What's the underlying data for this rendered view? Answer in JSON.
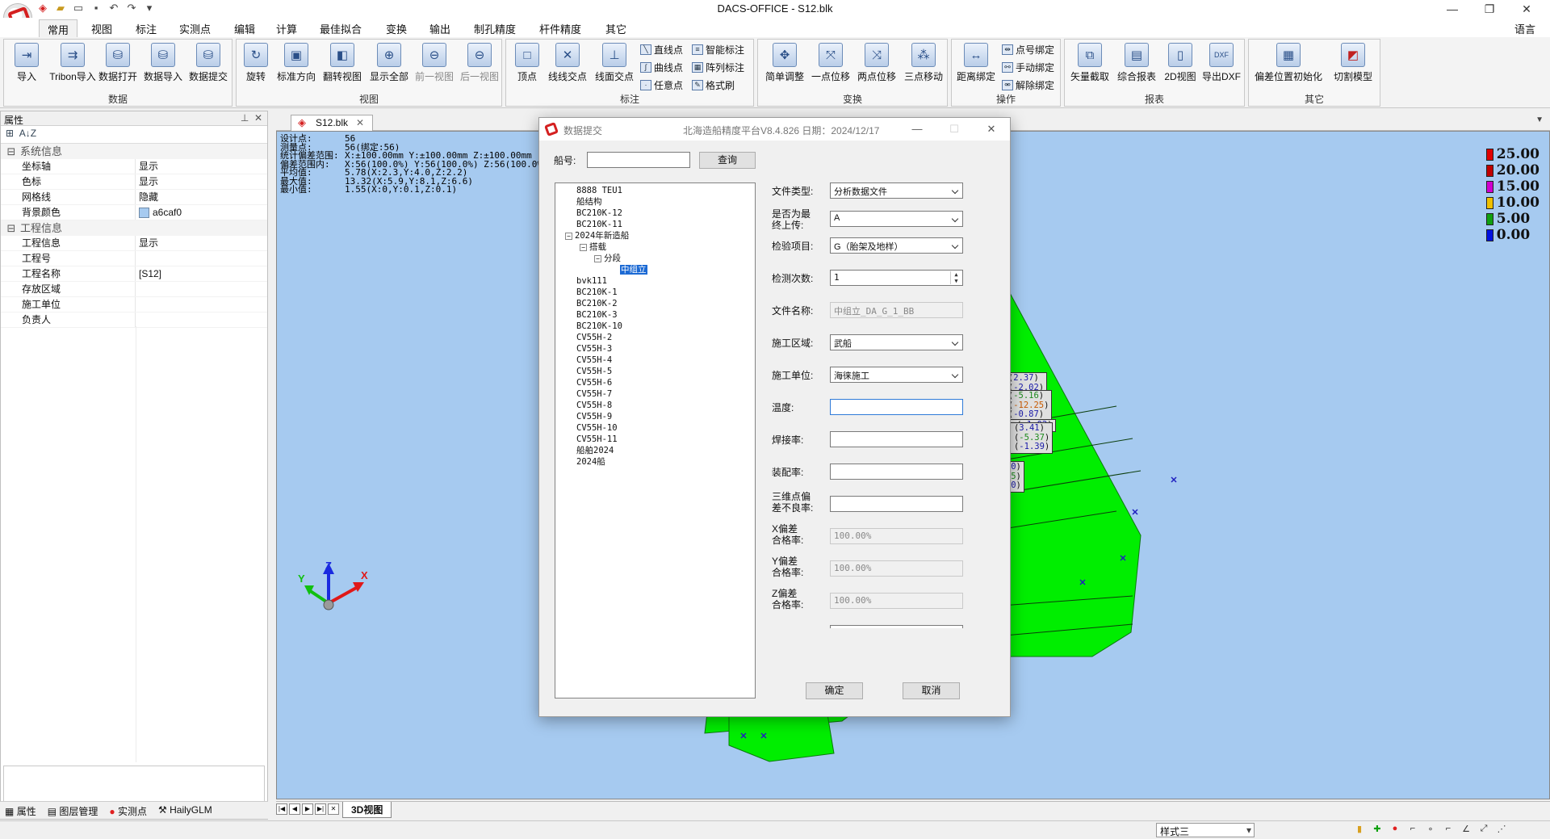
{
  "app": {
    "title": "DACS-OFFICE  -  S12.blk",
    "language_label": "语言",
    "tabs": [
      "常用",
      "视图",
      "标注",
      "实测点",
      "编辑",
      "计算",
      "最佳拟合",
      "变换",
      "输出",
      "制孔精度",
      "杆件精度",
      "其它"
    ]
  },
  "ribbon": {
    "groups": {
      "data": "数据",
      "view": "视图",
      "mark": "标注",
      "transform": "变换",
      "operate": "操作",
      "report": "报表",
      "other": "其它"
    },
    "buttons": {
      "import": "导入",
      "tribon_import": "Tribon导入",
      "data_open": "数据打开",
      "data_import": "数据导入",
      "data_submit": "数据提交",
      "rotate": "旋转",
      "std_direction": "标准方向",
      "flip_view": "翻转视图",
      "show_all": "显示全部",
      "prev_view": "前一视图",
      "next_view": "后一视图",
      "vertex": "顶点",
      "line_intersect": "线线交点",
      "line_plane_intersect": "线面交点",
      "line_point": "直线点",
      "curve_point": "曲线点",
      "any_point": "任意点",
      "smart_mark": "智能标注",
      "array_mark": "阵列标注",
      "format_brush": "格式刷",
      "simple_adjust": "简单调整",
      "one_point_move": "一点位移",
      "two_point_move": "两点位移",
      "three_point_move": "三点移动",
      "distance_bind": "距离绑定",
      "point_bind": "点号绑定",
      "manual_bind": "手动绑定",
      "unbind": "解除绑定",
      "vector_capture": "矢量截取",
      "summary_report": "综合报表",
      "view_2d": "2D视图",
      "export_dxf": "导出DXF",
      "deviation_init": "偏差位置初始化",
      "cut_model": "切割模型"
    }
  },
  "left_panel": {
    "title": "属性",
    "categories": [
      {
        "name": "系统信息",
        "rows": [
          {
            "k": "坐标轴",
            "v": "显示"
          },
          {
            "k": "色标",
            "v": "显示"
          },
          {
            "k": "网格线",
            "v": "隐藏"
          },
          {
            "k": "背景颜色",
            "v": "a6caf0"
          }
        ]
      },
      {
        "name": "工程信息",
        "rows": [
          {
            "k": "工程信息",
            "v": "显示"
          },
          {
            "k": "工程号",
            "v": ""
          },
          {
            "k": "工程名称",
            "v": "[S12]"
          },
          {
            "k": "存放区域",
            "v": ""
          },
          {
            "k": "施工单位",
            "v": ""
          },
          {
            "k": "负责人",
            "v": ""
          }
        ]
      }
    ],
    "bottom_tabs": [
      "属性",
      "图层管理",
      "实测点",
      "HailyGLM"
    ]
  },
  "document": {
    "tab": "S12.blk",
    "view_tab": "3D视图",
    "background_color": "#a6caf0",
    "info": [
      {
        "label": "设计点:",
        "value": "56"
      },
      {
        "label": "测量点:",
        "value": "56(绑定:56)"
      },
      {
        "label": "统计偏差范围:",
        "value": "X:±100.00mm Y:±100.00mm Z:±100.00mm"
      },
      {
        "label": "偏差范围内:",
        "value": "X:56(100.0%) Y:56(100.0%) Z:56(100.0%)"
      },
      {
        "label": "平均值:",
        "value": "5.78(X:2.3,Y:4.0,Z:2.2)"
      },
      {
        "label": "最大值:",
        "value": "13.32(X:5.9,Y:8.1,Z:6.6)"
      },
      {
        "label": "最小值:",
        "value": "1.55(X:0,Y:0.1,Z:0.1)"
      }
    ],
    "legend": [
      {
        "value": "25.00",
        "color": "#e00000"
      },
      {
        "value": "20.00",
        "color": "#c00000"
      },
      {
        "value": "15.00",
        "color": "#d000d0"
      },
      {
        "value": "10.00",
        "color": "#f0c000"
      },
      {
        "value": "5.00",
        "color": "#10a010"
      },
      {
        "value": "0.00",
        "color": "#0010e0"
      }
    ],
    "axes": {
      "x": "X",
      "y": "Y",
      "z": "Z"
    }
  },
  "dialog": {
    "title": "数据提交",
    "subtitle": "北海造船精度平台V8.4.826 日期：2024/12/17",
    "ship_no_label": "船号:",
    "query_button": "查询",
    "tree": [
      "8888  TEU1",
      "船结构",
      "BC210K-12",
      "BC210K-11",
      "2024年新造船",
      "搭载",
      "分段",
      "中组立",
      "bvk111",
      "BC210K-1",
      "BC210K-2",
      "BC210K-3",
      "BC210K-10",
      "CV55H-2",
      "CV55H-3",
      "CV55H-4",
      "CV55H-5",
      "CV55H-6",
      "CV55H-7",
      "CV55H-8",
      "CV55H-9",
      "CV55H-10",
      "CV55H-11",
      "船舶2024",
      "2024船"
    ],
    "fields": {
      "file_type": {
        "label": "文件类型:",
        "value": "分析数据文件"
      },
      "last_upload": {
        "label": "是否为最\n终上传:",
        "value": "A"
      },
      "inspect_item": {
        "label": "检验项目:",
        "value": "G（胎架及地样）"
      },
      "inspect_count": {
        "label": "检测次数:",
        "value": "1"
      },
      "file_name": {
        "label": "文件名称:",
        "value": "中组立_DA_G_1_BB"
      },
      "area": {
        "label": "施工区域:",
        "value": "武船"
      },
      "unit": {
        "label": "施工单位:",
        "value": "海徕施工"
      },
      "temperature": {
        "label": "温度:",
        "value": ""
      },
      "weld_rate": {
        "label": "焊接率:",
        "value": ""
      },
      "assembly_rate": {
        "label": "装配率:",
        "value": ""
      },
      "defect_rate": {
        "label": "三维点偏\n差不良率:",
        "value": ""
      },
      "x_pass": {
        "label": "X偏差\n合格率:",
        "value": "100.00%"
      },
      "y_pass": {
        "label": "Y偏差\n合格率:",
        "value": "100.00%"
      },
      "z_pass": {
        "label": "Z偏差\n合格率:",
        "value": "100.00%"
      }
    },
    "ok": "确定",
    "cancel": "取消"
  },
  "statusbar": {
    "style": "样式三"
  }
}
